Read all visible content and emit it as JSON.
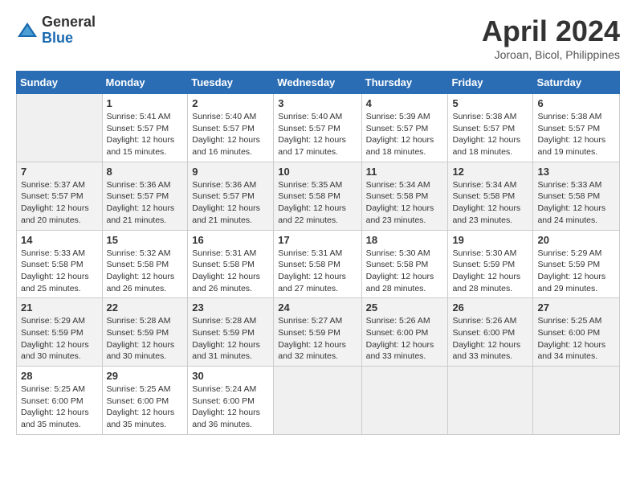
{
  "logo": {
    "general": "General",
    "blue": "Blue"
  },
  "title": "April 2024",
  "subtitle": "Joroan, Bicol, Philippines",
  "headers": [
    "Sunday",
    "Monday",
    "Tuesday",
    "Wednesday",
    "Thursday",
    "Friday",
    "Saturday"
  ],
  "weeks": [
    [
      {
        "num": "",
        "info": ""
      },
      {
        "num": "1",
        "info": "Sunrise: 5:41 AM\nSunset: 5:57 PM\nDaylight: 12 hours\nand 15 minutes."
      },
      {
        "num": "2",
        "info": "Sunrise: 5:40 AM\nSunset: 5:57 PM\nDaylight: 12 hours\nand 16 minutes."
      },
      {
        "num": "3",
        "info": "Sunrise: 5:40 AM\nSunset: 5:57 PM\nDaylight: 12 hours\nand 17 minutes."
      },
      {
        "num": "4",
        "info": "Sunrise: 5:39 AM\nSunset: 5:57 PM\nDaylight: 12 hours\nand 18 minutes."
      },
      {
        "num": "5",
        "info": "Sunrise: 5:38 AM\nSunset: 5:57 PM\nDaylight: 12 hours\nand 18 minutes."
      },
      {
        "num": "6",
        "info": "Sunrise: 5:38 AM\nSunset: 5:57 PM\nDaylight: 12 hours\nand 19 minutes."
      }
    ],
    [
      {
        "num": "7",
        "info": "Sunrise: 5:37 AM\nSunset: 5:57 PM\nDaylight: 12 hours\nand 20 minutes."
      },
      {
        "num": "8",
        "info": "Sunrise: 5:36 AM\nSunset: 5:57 PM\nDaylight: 12 hours\nand 21 minutes."
      },
      {
        "num": "9",
        "info": "Sunrise: 5:36 AM\nSunset: 5:57 PM\nDaylight: 12 hours\nand 21 minutes."
      },
      {
        "num": "10",
        "info": "Sunrise: 5:35 AM\nSunset: 5:58 PM\nDaylight: 12 hours\nand 22 minutes."
      },
      {
        "num": "11",
        "info": "Sunrise: 5:34 AM\nSunset: 5:58 PM\nDaylight: 12 hours\nand 23 minutes."
      },
      {
        "num": "12",
        "info": "Sunrise: 5:34 AM\nSunset: 5:58 PM\nDaylight: 12 hours\nand 23 minutes."
      },
      {
        "num": "13",
        "info": "Sunrise: 5:33 AM\nSunset: 5:58 PM\nDaylight: 12 hours\nand 24 minutes."
      }
    ],
    [
      {
        "num": "14",
        "info": "Sunrise: 5:33 AM\nSunset: 5:58 PM\nDaylight: 12 hours\nand 25 minutes."
      },
      {
        "num": "15",
        "info": "Sunrise: 5:32 AM\nSunset: 5:58 PM\nDaylight: 12 hours\nand 26 minutes."
      },
      {
        "num": "16",
        "info": "Sunrise: 5:31 AM\nSunset: 5:58 PM\nDaylight: 12 hours\nand 26 minutes."
      },
      {
        "num": "17",
        "info": "Sunrise: 5:31 AM\nSunset: 5:58 PM\nDaylight: 12 hours\nand 27 minutes."
      },
      {
        "num": "18",
        "info": "Sunrise: 5:30 AM\nSunset: 5:58 PM\nDaylight: 12 hours\nand 28 minutes."
      },
      {
        "num": "19",
        "info": "Sunrise: 5:30 AM\nSunset: 5:59 PM\nDaylight: 12 hours\nand 28 minutes."
      },
      {
        "num": "20",
        "info": "Sunrise: 5:29 AM\nSunset: 5:59 PM\nDaylight: 12 hours\nand 29 minutes."
      }
    ],
    [
      {
        "num": "21",
        "info": "Sunrise: 5:29 AM\nSunset: 5:59 PM\nDaylight: 12 hours\nand 30 minutes."
      },
      {
        "num": "22",
        "info": "Sunrise: 5:28 AM\nSunset: 5:59 PM\nDaylight: 12 hours\nand 30 minutes."
      },
      {
        "num": "23",
        "info": "Sunrise: 5:28 AM\nSunset: 5:59 PM\nDaylight: 12 hours\nand 31 minutes."
      },
      {
        "num": "24",
        "info": "Sunrise: 5:27 AM\nSunset: 5:59 PM\nDaylight: 12 hours\nand 32 minutes."
      },
      {
        "num": "25",
        "info": "Sunrise: 5:26 AM\nSunset: 6:00 PM\nDaylight: 12 hours\nand 33 minutes."
      },
      {
        "num": "26",
        "info": "Sunrise: 5:26 AM\nSunset: 6:00 PM\nDaylight: 12 hours\nand 33 minutes."
      },
      {
        "num": "27",
        "info": "Sunrise: 5:25 AM\nSunset: 6:00 PM\nDaylight: 12 hours\nand 34 minutes."
      }
    ],
    [
      {
        "num": "28",
        "info": "Sunrise: 5:25 AM\nSunset: 6:00 PM\nDaylight: 12 hours\nand 35 minutes."
      },
      {
        "num": "29",
        "info": "Sunrise: 5:25 AM\nSunset: 6:00 PM\nDaylight: 12 hours\nand 35 minutes."
      },
      {
        "num": "30",
        "info": "Sunrise: 5:24 AM\nSunset: 6:00 PM\nDaylight: 12 hours\nand 36 minutes."
      },
      {
        "num": "",
        "info": ""
      },
      {
        "num": "",
        "info": ""
      },
      {
        "num": "",
        "info": ""
      },
      {
        "num": "",
        "info": ""
      }
    ]
  ]
}
